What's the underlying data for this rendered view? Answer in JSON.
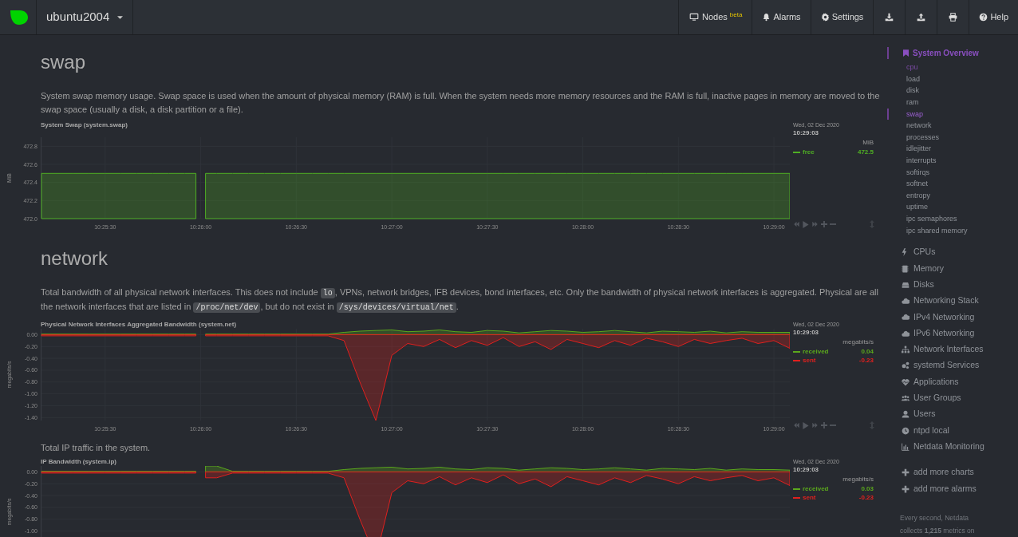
{
  "header": {
    "host": "ubuntu2004",
    "buttons": [
      {
        "kind": "nodes",
        "label": "Nodes",
        "badge": "beta"
      },
      {
        "kind": "alarms",
        "label": "Alarms"
      },
      {
        "kind": "settings",
        "label": "Settings"
      },
      {
        "kind": "download"
      },
      {
        "kind": "upload"
      },
      {
        "kind": "print"
      },
      {
        "kind": "help",
        "label": "Help"
      }
    ]
  },
  "sections": [
    {
      "heading": "swap",
      "description": [
        {
          "kind": "text",
          "text": "System swap memory usage. Swap space is used when the amount of physical memory (RAM) is full. When the system needs more memory resources and the RAM is full, inactive pages in memory are moved to the swap space (usually a disk, a disk partition or a file)."
        }
      ],
      "charts": [
        {
          "title": "System Swap (system.swap)",
          "legend": {
            "date": "Wed, 02 Dec 2020",
            "time": "10:29:03",
            "units": "MiB",
            "values": [
              "472.5"
            ]
          },
          "chart_data": {
            "type": "area",
            "ylabel": "MiB",
            "grid": true,
            "categories": [
              null,
              null,
              null,
              null,
              "10:25:30",
              null,
              null,
              null,
              null,
              null,
              "10:26:00",
              null,
              null,
              null,
              null,
              null,
              "10:26:30",
              null,
              null,
              null,
              null,
              null,
              "10:27:00",
              null,
              null,
              null,
              null,
              null,
              "10:27:30",
              null,
              null,
              null,
              null,
              null,
              "10:28:00",
              null,
              null,
              null,
              null,
              null,
              "10:28:30",
              null,
              null,
              null,
              null,
              null,
              "10:29:00",
              null
            ],
            "series": [
              {
                "name": "free",
                "color": "#4fae24",
                "values": [
                  472.5,
                  472.5,
                  472.5,
                  472.5,
                  472.5,
                  472.5,
                  472.5,
                  472.5,
                  472.5,
                  472.5,
                  null,
                  472.5,
                  472.5,
                  472.5,
                  472.5,
                  472.5,
                  472.5,
                  472.5,
                  472.5,
                  472.5,
                  472.5,
                  472.5,
                  472.5,
                  472.5,
                  472.5,
                  472.5,
                  472.5,
                  472.5,
                  472.5,
                  472.5,
                  472.5,
                  472.5,
                  472.5,
                  472.5,
                  472.5,
                  472.5,
                  472.5,
                  472.5,
                  472.5,
                  472.5,
                  472.5,
                  472.5,
                  472.5,
                  472.5,
                  472.5,
                  472.5,
                  472.5,
                  472.5
                ]
              }
            ],
            "ylim": [
              472.0,
              472.9
            ],
            "yticks": [
              {
                "value": 472.0,
                "label": "472.0"
              },
              {
                "value": 472.2,
                "label": "472.2"
              },
              {
                "value": 472.4,
                "label": "472.4"
              },
              {
                "value": 472.6,
                "label": "472.6"
              },
              {
                "value": 472.8,
                "label": "472.8"
              }
            ]
          }
        }
      ]
    },
    {
      "heading": "network",
      "description": [
        {
          "kind": "text",
          "text": "Total bandwidth of all physical network interfaces. This does not include "
        },
        {
          "kind": "code",
          "text": "lo"
        },
        {
          "kind": "text",
          "text": ", VPNs, network bridges, IFB devices, bond interfaces, etc. Only the bandwidth of physical network interfaces is aggregated. Physical are all the network interfaces that are listed in "
        },
        {
          "kind": "code",
          "text": "/proc/net/dev"
        },
        {
          "kind": "text",
          "text": ", but do not exist in "
        },
        {
          "kind": "code",
          "text": "/sys/devices/virtual/net"
        },
        {
          "kind": "text",
          "text": "."
        }
      ],
      "charts": [
        {
          "title": "Physical Network Interfaces Aggregated Bandwidth (system.net)",
          "legend": {
            "date": "Wed, 02 Dec 2020",
            "time": "10:29:03",
            "units": "megabits/s",
            "values": [
              "0.04",
              "-0.23"
            ]
          },
          "chart_data": {
            "type": "area",
            "ylabel": "megabits/s",
            "grid": true,
            "categories": [
              null,
              null,
              null,
              null,
              "10:25:30",
              null,
              null,
              null,
              null,
              null,
              "10:26:00",
              null,
              null,
              null,
              null,
              null,
              "10:26:30",
              null,
              null,
              null,
              null,
              null,
              "10:27:00",
              null,
              null,
              null,
              null,
              null,
              "10:27:30",
              null,
              null,
              null,
              null,
              null,
              "10:28:00",
              null,
              null,
              null,
              null,
              null,
              "10:28:30",
              null,
              null,
              null,
              null,
              null,
              "10:29:00",
              null
            ],
            "series": [
              {
                "name": "received",
                "color": "#5ba81c",
                "values": [
                  0.01,
                  0.01,
                  0.01,
                  0.01,
                  0.01,
                  0.01,
                  0.01,
                  0.01,
                  0.01,
                  0.01,
                  null,
                  0.01,
                  0.01,
                  0.01,
                  0.01,
                  0.01,
                  0.01,
                  0.01,
                  0.01,
                  0.04,
                  0.06,
                  0.07,
                  0.08,
                  0.05,
                  0.06,
                  0.08,
                  0.05,
                  0.04,
                  0.07,
                  0.06,
                  0.03,
                  0.05,
                  0.07,
                  0.06,
                  0.04,
                  0.05,
                  0.07,
                  0.05,
                  0.03,
                  0.06,
                  0.05,
                  0.04,
                  0.06,
                  0.03,
                  0.05,
                  0.04,
                  0.04,
                  0.04
                ]
              },
              {
                "name": "sent",
                "color": "#e0201e",
                "values": [
                  -0.02,
                  -0.02,
                  -0.02,
                  -0.02,
                  -0.02,
                  -0.02,
                  -0.02,
                  -0.02,
                  -0.02,
                  -0.02,
                  null,
                  -0.02,
                  -0.02,
                  -0.02,
                  -0.02,
                  -0.02,
                  -0.02,
                  -0.02,
                  -0.02,
                  -0.1,
                  -0.8,
                  -1.45,
                  -0.35,
                  -0.15,
                  -0.2,
                  -0.08,
                  -0.22,
                  -0.1,
                  -0.18,
                  -0.05,
                  -0.2,
                  -0.12,
                  -0.25,
                  -0.08,
                  -0.15,
                  -0.22,
                  -0.1,
                  -0.18,
                  -0.06,
                  -0.12,
                  -0.2,
                  -0.08,
                  -0.15,
                  -0.1,
                  -0.06,
                  -0.15,
                  -0.1,
                  -0.23
                ]
              }
            ],
            "ylim": [
              -1.45,
              0.1
            ],
            "yticks": [
              {
                "value": 0,
                "label": "0.00"
              },
              {
                "value": -0.2,
                "label": "-0.20"
              },
              {
                "value": -0.4,
                "label": "-0.40"
              },
              {
                "value": -0.6,
                "label": "-0.60"
              },
              {
                "value": -0.8,
                "label": "-0.80"
              },
              {
                "value": -1.0,
                "label": "-1.00"
              },
              {
                "value": -1.2,
                "label": "-1.20"
              },
              {
                "value": -1.4,
                "label": "-1.40"
              }
            ]
          }
        },
        {
          "intro": "Total IP traffic in the system.",
          "title": "IP Bandwidth (system.ip)",
          "legend": {
            "date": "Wed, 02 Dec 2020",
            "time": "10:29:03",
            "units": "megabits/s",
            "values": [
              "0.03",
              "-0.23"
            ]
          },
          "chart_data": {
            "type": "area",
            "ylabel": "megabits/s",
            "grid": true,
            "categories": [
              null,
              null,
              null,
              null,
              null,
              null,
              null,
              null,
              null,
              null,
              null,
              null,
              null,
              null,
              null,
              null,
              null,
              null,
              null,
              null,
              null,
              null,
              null,
              null,
              null,
              null,
              null,
              null,
              null,
              null,
              null,
              null,
              null,
              null,
              null,
              null,
              null,
              null,
              null,
              null,
              null,
              null,
              null,
              null,
              null,
              null,
              null,
              null
            ],
            "series": [
              {
                "name": "received",
                "color": "#5ba81c",
                "values": [
                  0.01,
                  0.01,
                  0.01,
                  0.01,
                  0.01,
                  0.01,
                  0.01,
                  0.01,
                  0.01,
                  0.01,
                  null,
                  0.1,
                  0.01,
                  0.01,
                  0.01,
                  0.01,
                  0.01,
                  0.01,
                  0.01,
                  0.04,
                  0.06,
                  0.07,
                  0.08,
                  0.05,
                  0.06,
                  0.08,
                  0.05,
                  0.04,
                  0.07,
                  0.06,
                  0.03,
                  0.05,
                  0.07,
                  0.06,
                  0.04,
                  0.05,
                  0.07,
                  0.05,
                  0.03,
                  0.06,
                  0.05,
                  0.04,
                  0.06,
                  0.03,
                  0.05,
                  0.04,
                  0.04,
                  0.03
                ]
              },
              {
                "name": "sent",
                "color": "#e0201e",
                "values": [
                  -0.02,
                  -0.02,
                  -0.02,
                  -0.02,
                  -0.02,
                  -0.02,
                  -0.02,
                  -0.02,
                  -0.02,
                  -0.02,
                  null,
                  -0.1,
                  -0.02,
                  -0.02,
                  -0.02,
                  -0.02,
                  -0.02,
                  -0.02,
                  -0.02,
                  -0.1,
                  -0.8,
                  -1.45,
                  -0.35,
                  -0.15,
                  -0.2,
                  -0.08,
                  -0.22,
                  -0.1,
                  -0.18,
                  -0.05,
                  -0.2,
                  -0.12,
                  -0.25,
                  -0.08,
                  -0.15,
                  -0.22,
                  -0.1,
                  -0.18,
                  -0.06,
                  -0.12,
                  -0.2,
                  -0.08,
                  -0.15,
                  -0.1,
                  -0.06,
                  -0.15,
                  -0.1,
                  -0.23
                ]
              }
            ],
            "ylim": [
              -1.45,
              0.1
            ],
            "yticks": [
              {
                "value": 0,
                "label": "0.00"
              },
              {
                "value": -0.2,
                "label": "-0.20"
              },
              {
                "value": -0.4,
                "label": "-0.40"
              },
              {
                "value": -0.6,
                "label": "-0.60"
              },
              {
                "value": -0.8,
                "label": "-0.80"
              },
              {
                "value": -1.0,
                "label": "-1.00"
              }
            ]
          }
        }
      ]
    }
  ],
  "sidebar": {
    "overview": {
      "label": "System Overview",
      "items": [
        {
          "label": "cpu",
          "selected": false,
          "faded": true
        },
        {
          "label": "load",
          "selected": false,
          "faded": false
        },
        {
          "label": "disk",
          "selected": false,
          "faded": false
        },
        {
          "label": "ram",
          "selected": false,
          "faded": false
        },
        {
          "label": "swap",
          "selected": true,
          "faded": false
        },
        {
          "label": "network",
          "selected": false,
          "faded": false
        },
        {
          "label": "processes",
          "selected": false,
          "faded": false
        },
        {
          "label": "idlejitter",
          "selected": false,
          "faded": false
        },
        {
          "label": "interrupts",
          "selected": false,
          "faded": false
        },
        {
          "label": "softirqs",
          "selected": false,
          "faded": false
        },
        {
          "label": "softnet",
          "selected": false,
          "faded": false
        },
        {
          "label": "entropy",
          "selected": false,
          "faded": false
        },
        {
          "label": "uptime",
          "selected": false,
          "faded": false
        },
        {
          "label": "ipc semaphores",
          "selected": false,
          "faded": false
        },
        {
          "label": "ipc shared memory",
          "selected": false,
          "faded": false
        }
      ]
    },
    "sections": [
      "CPUs",
      "Memory",
      "Disks",
      "Networking Stack",
      "IPv4 Networking",
      "IPv6 Networking",
      "Network Interfaces",
      "systemd Services",
      "Applications",
      "User Groups",
      "Users",
      "ntpd local",
      "Netdata Monitoring"
    ],
    "actions": [
      "add more charts",
      "add more alarms"
    ],
    "footer": "Every second, Netdata collects **1,215** metrics on"
  }
}
